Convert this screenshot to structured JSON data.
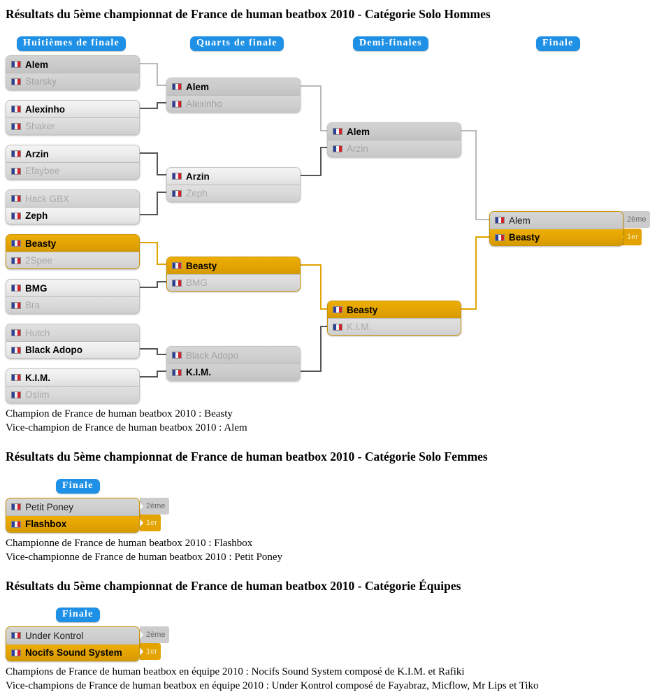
{
  "sections": [
    {
      "id": "hommes",
      "title": "Résultats du 5ème championnat de France de human beatbox 2010 - Catégorie Solo Hommes",
      "rounds": [
        {
          "label": "Huitièmes de finale"
        },
        {
          "label": "Quarts de finale"
        },
        {
          "label": "Demi-finales"
        },
        {
          "label": "Finale"
        }
      ],
      "r16": [
        {
          "top": "Alem",
          "bottom": "Starsky",
          "winner": "top"
        },
        {
          "top": "Alexinho",
          "bottom": "Shaker",
          "winner": "top"
        },
        {
          "top": "Arzin",
          "bottom": "Efaybee",
          "winner": "top"
        },
        {
          "top": "Hack GBX",
          "bottom": "Zeph",
          "winner": "bottom"
        },
        {
          "top": "Beasty",
          "bottom": "2Spee",
          "winner": "top"
        },
        {
          "top": "BMG",
          "bottom": "Bra",
          "winner": "top"
        },
        {
          "top": "Hutch",
          "bottom": "Black Adopo",
          "winner": "bottom"
        },
        {
          "top": "K.I.M.",
          "bottom": "Oslim",
          "winner": "top"
        }
      ],
      "quarters": [
        {
          "top": "Alem",
          "bottom": "Alexinho",
          "winner": "top"
        },
        {
          "top": "Arzin",
          "bottom": "Zeph",
          "winner": "top"
        },
        {
          "top": "Beasty",
          "bottom": "BMG",
          "winner": "top"
        },
        {
          "top": "Black Adopo",
          "bottom": "K.I.M.",
          "winner": "bottom"
        }
      ],
      "semis": [
        {
          "top": "Alem",
          "bottom": "Arzin",
          "winner": "top"
        },
        {
          "top": "Beasty",
          "bottom": "K.I.M.",
          "winner": "top"
        }
      ],
      "final": {
        "top": "Alem",
        "bottom": "Beasty",
        "winner": "bottom"
      },
      "badges": {
        "second": "2ème",
        "first": "1er"
      },
      "captions": [
        "Champion de France de human beatbox 2010 : Beasty",
        "Vice-champion de France de human beatbox 2010 : Alem"
      ]
    },
    {
      "id": "femmes",
      "title": "Résultats du 5ème championnat de France de human beatbox 2010 - Catégorie Solo Femmes",
      "rounds": [
        {
          "label": "Finale"
        }
      ],
      "final": {
        "top": "Petit Poney",
        "bottom": "Flashbox",
        "winner": "bottom"
      },
      "badges": {
        "second": "2ème",
        "first": "1er"
      },
      "captions": [
        "Championne de France de human beatbox 2010 : Flashbox",
        "Vice-championne de France de human beatbox 2010 : Petit Poney"
      ]
    },
    {
      "id": "equipes",
      "title": "Résultats du 5ème championnat de France de human beatbox 2010 - Catégorie Équipes",
      "rounds": [
        {
          "label": "Finale"
        }
      ],
      "final": {
        "top": "Under Kontrol",
        "bottom": "Nocifs Sound System",
        "winner": "bottom"
      },
      "badges": {
        "second": "2ème",
        "first": "1er"
      },
      "captions": [
        "Champions de France de human beatbox en équipe 2010 : Nocifs Sound System composé de K.I.M. et Rafiki",
        "Vice-champions de France de human beatbox en équipe 2010 : Under Kontrol composé de Fayabraz, Micflow, Mr Lips et Tiko"
      ]
    }
  ],
  "colors": {
    "round_pill": "#1e90e6",
    "champion_gold": "#e3a303",
    "winner_row": "#ebebeb",
    "loser_row": "#d6d6d6",
    "connector": "#555555",
    "connector_gold": "#e0a400"
  },
  "icons": {
    "flag": "french-flag-icon"
  }
}
